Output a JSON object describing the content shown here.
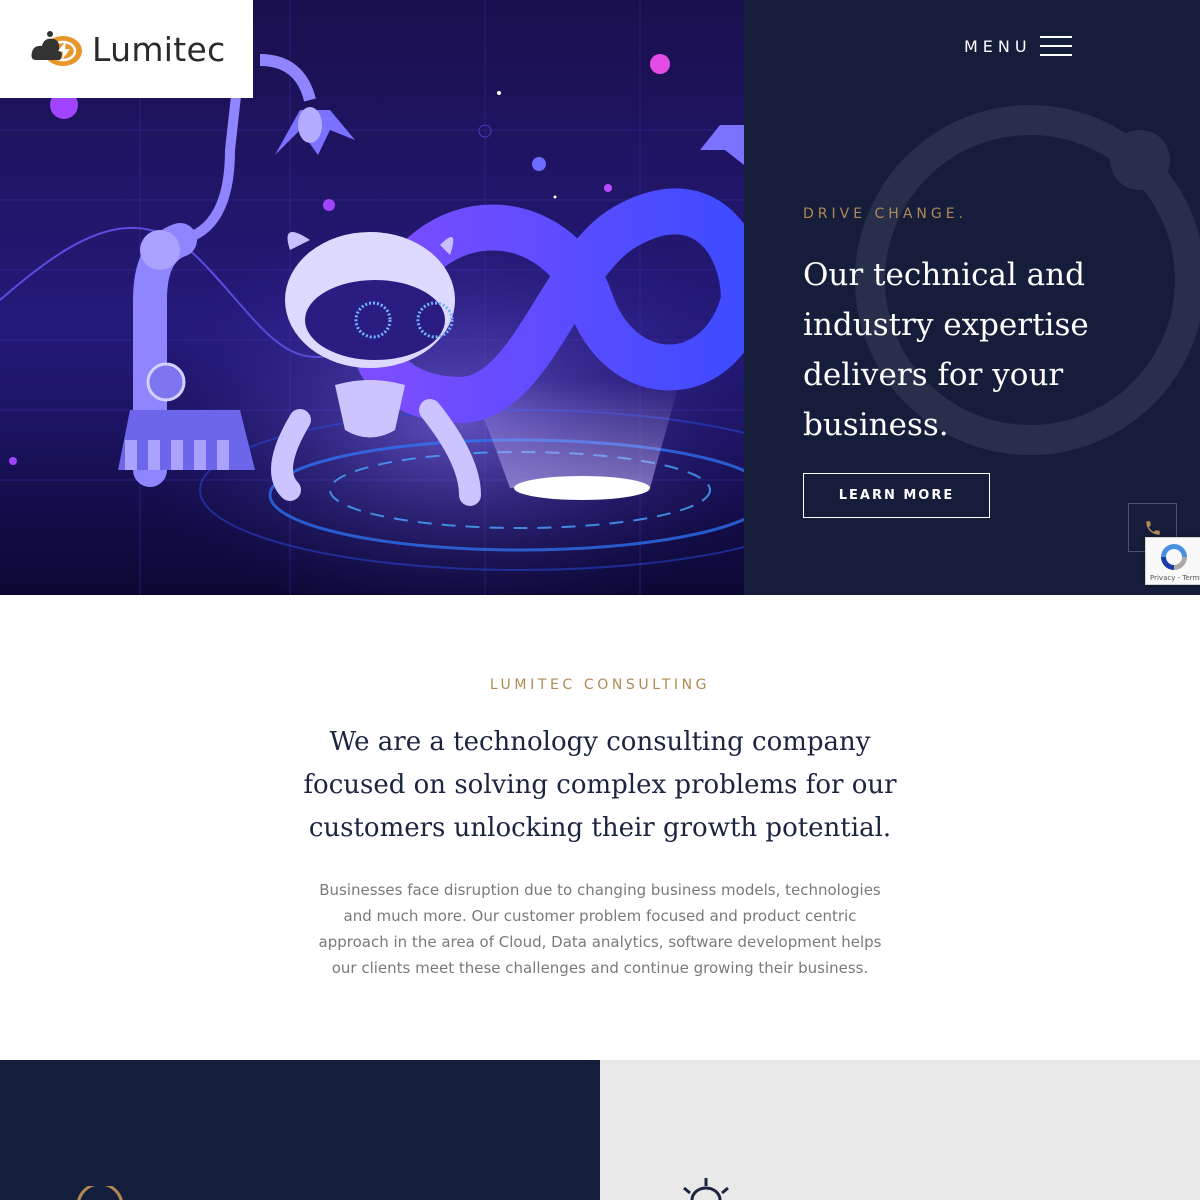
{
  "brand": {
    "name": "Lumitec",
    "accent": "#b08a54",
    "navy": "#151d3b"
  },
  "nav": {
    "menu_label": "MENU"
  },
  "hero": {
    "eyebrow": "DRIVE CHANGE.",
    "title": "Our technical and industry expertise delivers for your business.",
    "cta_label": "LEARN MORE",
    "phone_icon": "phone-icon"
  },
  "recaptcha": {
    "links": "Privacy - Terms"
  },
  "about": {
    "eyebrow": "LUMITEC CONSULTING",
    "heading": "We are a technology consulting company focused on solving complex problems for our customers unlocking their growth potential.",
    "body": "Businesses face disruption due to changing business models, technologies and much more. Our customer problem focused and product centric approach in the area of Cloud, Data analytics, software development helps our clients meet these challenges and continue growing their business."
  },
  "features": {
    "left_icon": "circle-icon",
    "right_icon": "lightbulb-icon"
  }
}
